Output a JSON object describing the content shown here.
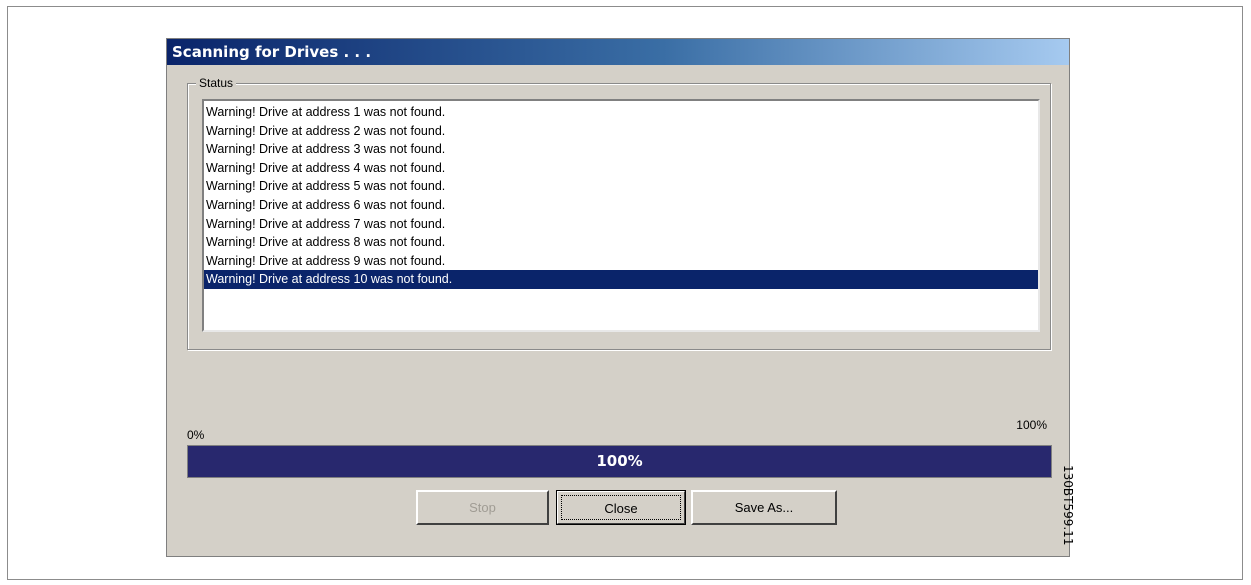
{
  "dialog": {
    "title": "Scanning for Drives . . .",
    "status_group_label": "Status",
    "status_lines": [
      "Warning! Drive at address 1 was not found.",
      "Warning! Drive at address 2 was not found.",
      "Warning! Drive at address 3 was not found.",
      "Warning! Drive at address 4 was not found.",
      "Warning! Drive at address 5 was not found.",
      "Warning! Drive at address 6 was not found.",
      "Warning! Drive at address 7 was not found.",
      "Warning! Drive at address 8 was not found.",
      "Warning! Drive at address 9 was not found.",
      "Warning! Drive at address 10 was not found."
    ],
    "selected_index": 9
  },
  "progress": {
    "min_label": "0%",
    "max_label": "100%",
    "value_label": "100%",
    "fraction": 1.0
  },
  "buttons": {
    "stop_label": "Stop",
    "close_label": "Close",
    "save_as_label": "Save As..."
  },
  "figure_code": "130BT599.11",
  "colors": {
    "selection": "#0a246a",
    "progress_fill": "#28286e",
    "dialog_face": "#d4d0c8"
  }
}
